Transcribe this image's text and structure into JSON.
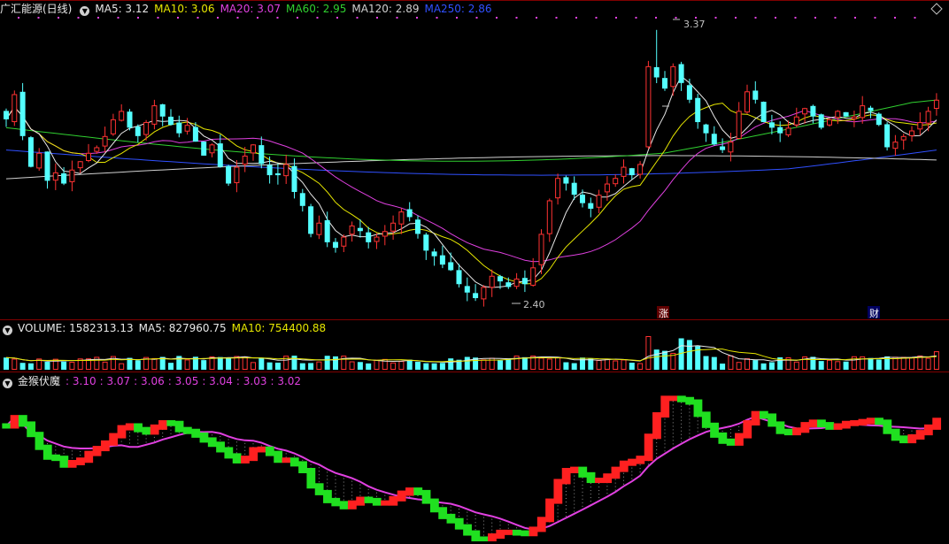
{
  "header": {
    "title": "广汇能源(日线)",
    "ma_items": [
      {
        "label": "MA5: 3.12",
        "color": "#e8e8e8"
      },
      {
        "label": "MA10: 3.06",
        "color": "#e6e600"
      },
      {
        "label": "MA20: 3.07",
        "color": "#e040e0"
      },
      {
        "label": "MA60: 2.95",
        "color": "#30d030"
      },
      {
        "label": "MA120: 2.89",
        "color": "#d0d0d0"
      },
      {
        "label": "MA250: 2.86",
        "color": "#3050ff"
      }
    ]
  },
  "volume_header": {
    "items": [
      {
        "label": "VOLUME: 1582313.13",
        "color": "#e8e8e8"
      },
      {
        "label": "MA5: 827960.75",
        "color": "#e8e8e8"
      },
      {
        "label": "MA10: 754400.88",
        "color": "#e6e600"
      }
    ]
  },
  "indicator_header": {
    "title": "金猴伏魔",
    "values": [
      ": 3.10",
      ": 3.07",
      ": 3.06",
      ": 3.05",
      ": 3.04",
      ": 3.03",
      ": 3.02"
    ],
    "color": "#e040e0"
  },
  "annotations": {
    "high_label": "3.37",
    "low_label": "2.40",
    "marker_zhang": "涨",
    "marker_cai": "财"
  },
  "colors": {
    "up": "#ff3232",
    "down": "#54ffff",
    "grid": "#800000",
    "ma5": "#e8e8e8",
    "ma10": "#e6e600",
    "ma20": "#e040e0",
    "ma60": "#30d030",
    "ma120": "#d0d0d0",
    "ma250": "#3050ff",
    "ind_up": "#ff2020",
    "ind_down": "#20e020",
    "ind_line": "#e040e0"
  },
  "chart_data": {
    "type": "candlestick",
    "price_range": [
      2.35,
      3.42
    ],
    "close": [
      3.05,
      3.14,
      2.99,
      2.88,
      2.93,
      2.83,
      2.86,
      2.82,
      2.87,
      2.9,
      2.93,
      2.95,
      2.99,
      3.05,
      3.08,
      3.02,
      2.99,
      3.04,
      3.1,
      3.06,
      3.03,
      3.0,
      3.03,
      2.97,
      2.92,
      2.96,
      2.88,
      2.82,
      2.88,
      2.92,
      2.96,
      2.89,
      2.85,
      2.85,
      2.89,
      2.79,
      2.74,
      2.64,
      2.68,
      2.61,
      2.59,
      2.63,
      2.67,
      2.65,
      2.61,
      2.63,
      2.65,
      2.68,
      2.72,
      2.7,
      2.64,
      2.58,
      2.56,
      2.53,
      2.51,
      2.46,
      2.43,
      2.41,
      2.45,
      2.49,
      2.47,
      2.45,
      2.48,
      2.46,
      2.52,
      2.64,
      2.76,
      2.84,
      2.82,
      2.78,
      2.75,
      2.73,
      2.78,
      2.82,
      2.84,
      2.88,
      2.85,
      2.89,
      3.24,
      3.2,
      3.16,
      3.24,
      3.18,
      3.12,
      3.04,
      3.0,
      2.96,
      2.94,
      2.97,
      3.08,
      3.15,
      3.12,
      3.04,
      3.02,
      3.0,
      3.02,
      3.06,
      3.09,
      3.06,
      3.02,
      3.05,
      3.08,
      3.06,
      3.06,
      3.1,
      3.08,
      3.03,
      2.95,
      2.97,
      2.99,
      3.01,
      3.04,
      3.08,
      3.12
    ]
  }
}
